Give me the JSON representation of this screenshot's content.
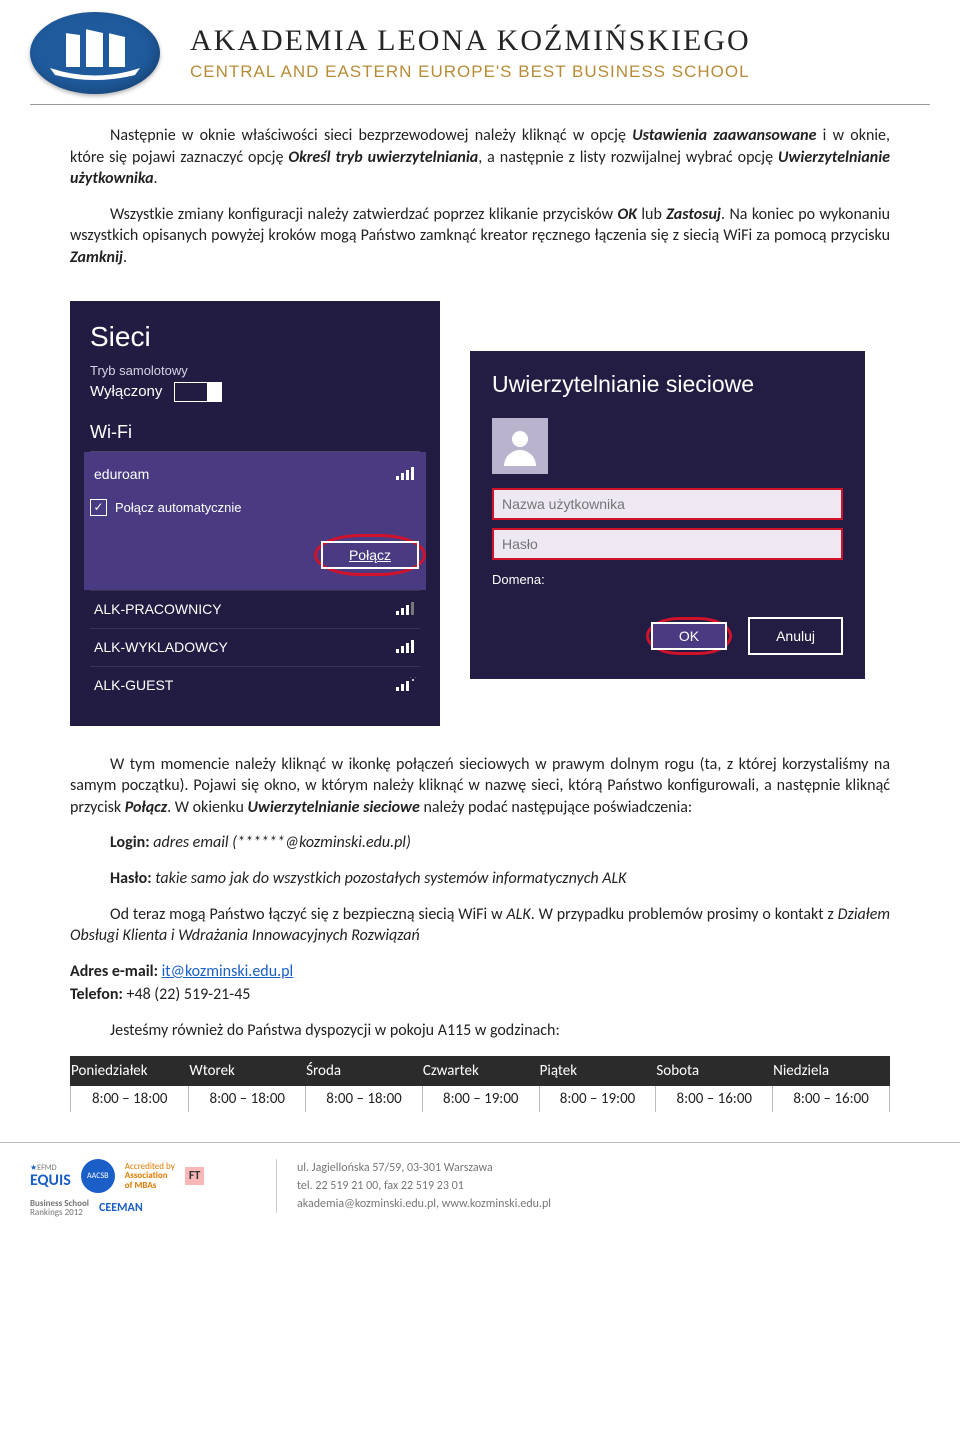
{
  "header": {
    "title": "AKADEMIA LEONA KOŹMIŃSKIEGO",
    "subtitle": "CENTRAL AND EASTERN EUROPE'S BEST BUSINESS SCHOOL"
  },
  "body": {
    "p1_a": "Następnie w oknie właściwości sieci bezprzewodowej należy kliknąć w opcję ",
    "p1_b": "Ustawienia zaawansowane",
    "p1_c": " i w oknie, które się pojawi zaznaczyć opcję ",
    "p1_d": "Określ tryb uwierzytelniania",
    "p1_e": ", a następnie z listy rozwijalnej wybrać opcję ",
    "p1_f": "Uwierzytelnianie użytkownika",
    "p1_g": ".",
    "p2_a": "Wszystkie zmiany konfiguracji należy zatwierdzać poprzez klikanie przycisków ",
    "p2_b": "OK",
    "p2_c": " lub ",
    "p2_d": "Zastosuj",
    "p2_e": ". Na koniec po wykonaniu wszystkich opisanych powyżej kroków mogą Państwo zamknąć kreator ręcznego łączenia się z siecią WiFi za pomocą przycisku ",
    "p2_f": "Zamknij",
    "p2_g": ".",
    "p3_a": "W tym momencie należy kliknąć w ikonkę połączeń sieciowych w prawym dolnym rogu (ta, z której korzystaliśmy na samym początku). Pojawi się okno, w którym należy kliknąć w nazwę sieci, którą Państwo konfigurowali, a następnie kliknąć przycisk ",
    "p3_b": "Połącz",
    "p3_c": ". W okienku ",
    "p3_d": "Uwierzytelnianie sieciowe",
    "p3_e": " należy podać następujące poświadczenia:",
    "login_label": "Login:",
    "login_val": " adres email (******@kozminski.edu.pl)",
    "haslo_label": "Hasło:",
    "haslo_val": " takie samo jak do wszystkich pozostałych systemów informatycznych ALK",
    "p4_a": "Od teraz mogą Państwo łączyć się z bezpieczną siecią WiFi w ",
    "p4_b": "ALK",
    "p4_c": ". W przypadku problemów prosimy o kontakt z ",
    "p4_d": "Działem Obsługi Klienta i Wdrażania Innowacyjnych Rozwiązań",
    "email_lbl": "Adres e-mail: ",
    "email_link": "it@kozminski.edu.pl",
    "tel_lbl": "Telefon: ",
    "tel_val": "+48 (22) 519-21-45",
    "p5": "Jesteśmy również do Państwa dyspozycji w pokoju A115 w godzinach:"
  },
  "net_panel": {
    "title": "Sieci",
    "airplane_lbl": "Tryb samolotowy",
    "airplane_val": "Wyłączony",
    "wifi_lbl": "Wi-Fi",
    "items": [
      "eduroam",
      "ALK-PRACOWNICY",
      "ALK-WYKLADOWCY",
      "ALK-GUEST"
    ],
    "auto": "Połącz automatycznie",
    "connect": "Połącz"
  },
  "auth_panel": {
    "title": "Uwierzytelnianie sieciowe",
    "user_ph": "Nazwa użytkownika",
    "pass_ph": "Hasło",
    "domain": "Domena:",
    "ok": "OK",
    "cancel": "Anuluj"
  },
  "hours": {
    "headers": [
      "Poniedziałek",
      "Wtorek",
      "Środa",
      "Czwartek",
      "Piątek",
      "Sobota",
      "Niedziela"
    ],
    "row": [
      "8:00 – 18:00",
      "8:00 – 18:00",
      "8:00 – 18:00",
      "8:00 – 19:00",
      "8:00 – 19:00",
      "8:00 – 16:00",
      "8:00 – 16:00"
    ]
  },
  "footer": {
    "equis": "EQUIS",
    "efmd": "EFMD",
    "aacsb": "AACSB",
    "amba1": "Accredited by",
    "amba2": "Association",
    "amba3": "of MBAs",
    "ft": "FT",
    "bsr1": "Business School",
    "bsr2": "Rankings 2012",
    "ceeman": "CEEMAN",
    "addr1": "ul. Jagiellońska 57/59, 03-301 Warszawa",
    "addr2": "tel. 22 519 21 00, fax 22 519 23 01",
    "addr3": "akademia@kozminski.edu.pl, www.kozminski.edu.pl"
  }
}
